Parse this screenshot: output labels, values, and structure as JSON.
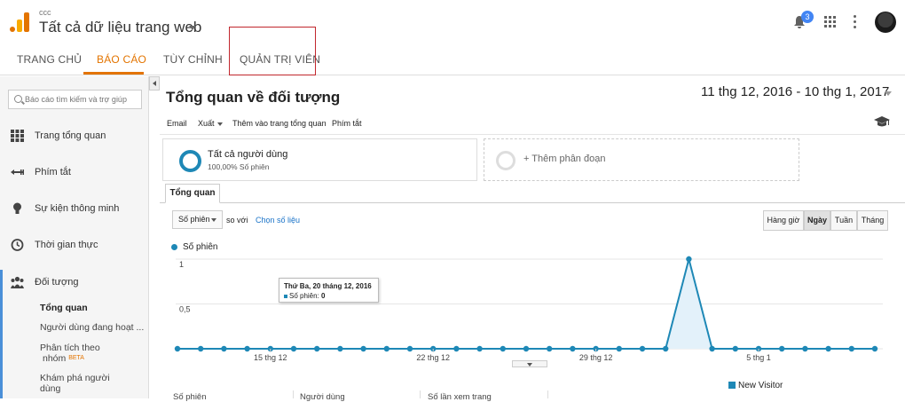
{
  "header": {
    "account": "ccc",
    "property": "Tất cả dữ liệu trang web",
    "notifications": "3"
  },
  "nav": {
    "tabs": [
      "TRANG CHỦ",
      "BÁO CÁO",
      "TÙY CHỈNH",
      "QUẢN TRỊ VIÊN"
    ],
    "active": "BÁO CÁO"
  },
  "sidebar": {
    "search_placeholder": "Báo cáo tìm kiếm và trợ giúp",
    "items": [
      "Trang tổng quan",
      "Phím tắt",
      "Sự kiện thông minh",
      "Thời gian thực",
      "Đối tượng"
    ],
    "sub_items": [
      "Tổng quan",
      "Người dùng đang hoạt ...",
      "Phân tích theo",
      "nhóm",
      "Khám phá người",
      "dùng"
    ],
    "beta": "BETA",
    "icons": [
      "grid-icon",
      "shortcut-icon",
      "bulb-icon",
      "clock-icon",
      "people-icon"
    ]
  },
  "main": {
    "title": "Tổng quan về đối tượng",
    "date_range": "11 thg 12, 2016 - 10 thg 1, 2017",
    "toolbar": [
      "Email",
      "Xuất",
      "Thêm vào trang tổng quan",
      "Phím tắt"
    ],
    "segment": {
      "title": "Tất cả người dùng",
      "subtitle": "100,00% Số phiên"
    },
    "add_segment": "+ Thêm phân đoạn",
    "tab": "Tổng quan",
    "metric": "Số phiên",
    "vs": "so với",
    "choose_metric": "Chọn số liệu",
    "granularity": [
      "Hàng giờ",
      "Ngày",
      "Tuần",
      "Tháng"
    ],
    "active_granularity": "Ngày",
    "tooltip": {
      "date": "Thứ Ba, 20 tháng 12, 2016",
      "label": "Số phiên:",
      "value": "0"
    },
    "bottom_columns": [
      "Số phiên",
      "Người dùng",
      "Số lần xem trang"
    ],
    "pie_legend": "New Visitor"
  },
  "chart_data": {
    "type": "line",
    "series": [
      {
        "name": "Số phiên",
        "values": [
          0,
          0,
          0,
          0,
          0,
          0,
          0,
          0,
          0,
          0,
          0,
          0,
          0,
          0,
          0,
          0,
          0,
          0,
          0,
          0,
          0,
          0,
          1,
          0,
          0,
          0,
          0,
          0,
          0,
          0,
          0
        ]
      }
    ],
    "x_tick_labels": [
      "15 thg 12",
      "22 thg 12",
      "29 thg 12",
      "5 thg 1"
    ],
    "y_ticks": [
      "1",
      "0,5"
    ],
    "ylim": [
      0,
      1
    ],
    "color": "#1e88b6"
  }
}
